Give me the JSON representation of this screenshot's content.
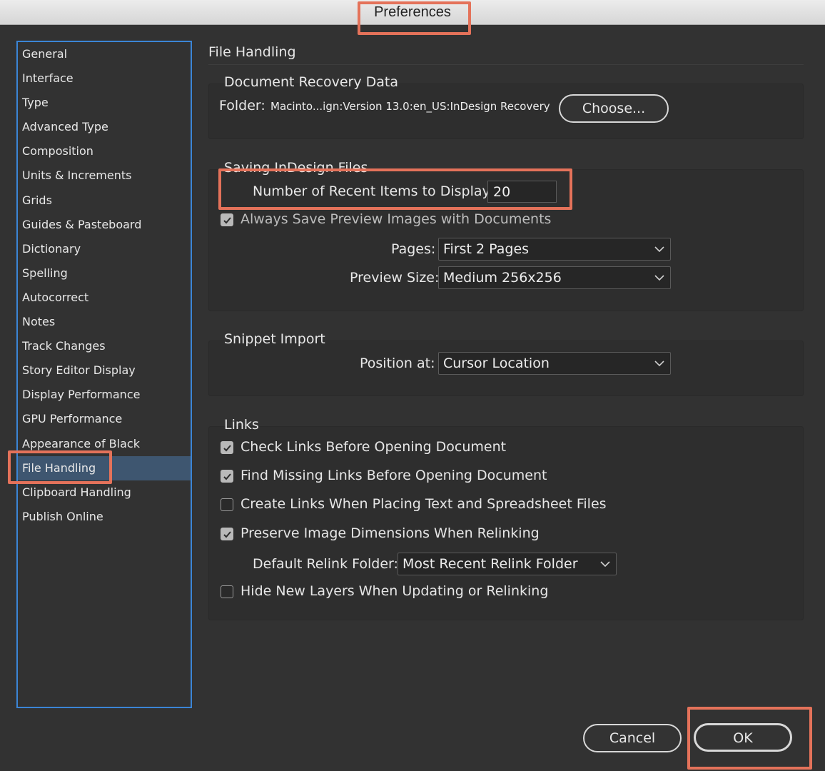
{
  "window": {
    "title": "Preferences"
  },
  "sidebar": {
    "items": [
      {
        "label": "General"
      },
      {
        "label": "Interface"
      },
      {
        "label": "Type"
      },
      {
        "label": "Advanced Type"
      },
      {
        "label": "Composition"
      },
      {
        "label": "Units & Increments"
      },
      {
        "label": "Grids"
      },
      {
        "label": "Guides & Pasteboard"
      },
      {
        "label": "Dictionary"
      },
      {
        "label": "Spelling"
      },
      {
        "label": "Autocorrect"
      },
      {
        "label": "Notes"
      },
      {
        "label": "Track Changes"
      },
      {
        "label": "Story Editor Display"
      },
      {
        "label": "Display Performance"
      },
      {
        "label": "GPU Performance"
      },
      {
        "label": "Appearance of Black"
      },
      {
        "label": "File Handling",
        "selected": true
      },
      {
        "label": "Clipboard Handling"
      },
      {
        "label": "Publish Online"
      }
    ]
  },
  "main": {
    "title": "File Handling",
    "recovery": {
      "heading": "Document Recovery Data",
      "folder_label": "Folder:",
      "folder_path": "Macinto...ign:Version 13.0:en_US:InDesign Recovery",
      "choose_label": "Choose..."
    },
    "saving": {
      "heading": "Saving InDesign Files",
      "recent_label": "Number of Recent Items to Display:",
      "recent_value": "20",
      "preview_label": "Always Save Preview Images with Documents",
      "preview_checked": true,
      "pages_label": "Pages:",
      "pages_value": "First 2 Pages",
      "size_label": "Preview Size:",
      "size_value": "Medium 256x256"
    },
    "snippet": {
      "heading": "Snippet Import",
      "position_label": "Position at:",
      "position_value": "Cursor Location"
    },
    "links": {
      "heading": "Links",
      "check_links": "Check Links Before Opening Document",
      "find_missing": "Find Missing Links Before Opening Document",
      "create_links": "Create Links When Placing Text and Spreadsheet Files",
      "preserve_dims": "Preserve Image Dimensions When Relinking",
      "relink_folder_label": "Default Relink Folder:",
      "relink_folder_value": "Most Recent Relink Folder",
      "hide_layers": "Hide New Layers When Updating or Relinking"
    }
  },
  "footer": {
    "cancel_label": "Cancel",
    "ok_label": "OK"
  },
  "colors": {
    "highlight": "#e4725a",
    "selection": "#3e5670",
    "sidebar_border": "#3b85d6"
  }
}
